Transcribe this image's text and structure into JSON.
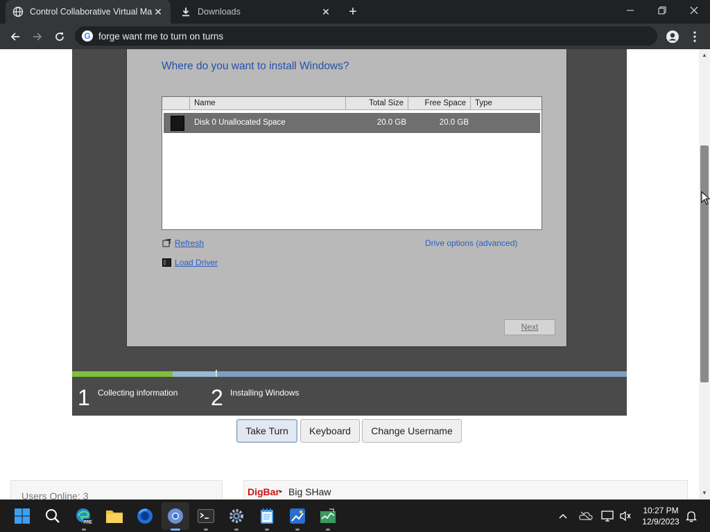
{
  "browser": {
    "tabs": [
      {
        "title": "Control Collaborative Virtual Ma",
        "active": true,
        "icon": "globe-icon"
      },
      {
        "title": "Downloads",
        "active": false,
        "icon": "download-icon"
      }
    ],
    "address": "forge want me to turn on turns"
  },
  "setup": {
    "heading": "Where do you want to install Windows?",
    "columns": {
      "name": "Name",
      "total_size": "Total Size",
      "free_space": "Free Space",
      "type": "Type"
    },
    "disks": [
      {
        "name": "Disk 0 Unallocated Space",
        "total_size": "20.0 GB",
        "free_space": "20.0 GB",
        "type": ""
      }
    ],
    "refresh": "Refresh",
    "load_driver": "Load Driver",
    "drive_options": "Drive options (advanced)",
    "next": "Next",
    "steps": [
      {
        "num": "1",
        "label": "Collecting information"
      },
      {
        "num": "2",
        "label": "Installing Windows"
      }
    ]
  },
  "controls": {
    "take_turn": "Take Turn",
    "keyboard": "Keyboard",
    "change_username": "Change Username"
  },
  "users_online": "Users Online: 3",
  "chat": {
    "brand": "DigBar",
    "arrow": "▸",
    "username": "Big SHaw"
  },
  "taskbar": {
    "time": "10:27 PM",
    "date": "12/9/2023",
    "apps": [
      "start-icon",
      "search-icon",
      "edge-preview-icon",
      "file-explorer-icon",
      "firefox-icon",
      "chrome-icon",
      "terminal-icon",
      "settings-icon",
      "notepad-icon",
      "paint-icon",
      "task-manager-icon"
    ],
    "edge_badge": "PRE"
  },
  "colors": {
    "accent_blue": "#2450a8",
    "progress_green": "#7fbf3b",
    "brand_red": "#c91414"
  }
}
